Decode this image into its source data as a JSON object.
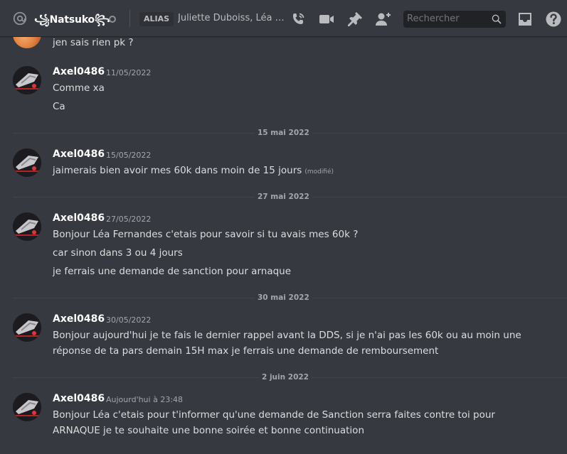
{
  "header": {
    "channel_name": "꧁Natsuko꧂",
    "alias_badge": "ALIAS",
    "alias_names": "Juliette Duboiss, Léa Fernandes",
    "search_placeholder": "Rechercher"
  },
  "messages": {
    "partial": {
      "text": "jen sais rien pk ?"
    },
    "groups": [
      {
        "author": "Axel0486",
        "timestamp": "11/05/2022",
        "lines": [
          "Comme xa",
          "Ca"
        ]
      },
      {
        "author": "Axel0486",
        "timestamp": "15/05/2022",
        "lines": [
          "jaimerais bien avoir mes 60k dans moin de 15 jours"
        ],
        "edited": "(modifié)"
      },
      {
        "author": "Axel0486",
        "timestamp": "27/05/2022",
        "lines": [
          "Bonjour Léa Fernandes c'etais pour savoir si tu avais mes 60k ?",
          "car sinon dans 3 ou 4 jours",
          "je ferrais une demande de sanction pour arnaque"
        ]
      },
      {
        "author": "Axel0486",
        "timestamp": "30/05/2022",
        "lines": [
          "Bonjour aujourd'hui je te fais le dernier rappel avant la DDS, si je n'ai pas les 60k ou au moin une",
          "réponse de ta pars demain 15H max je ferrais une demande de remboursement"
        ]
      },
      {
        "author": "Axel0486",
        "timestamp": "Aujourd'hui à 23:48",
        "lines": [
          "Bonjour Léa c'etais pour t'informer qu'une demande de Sanction serra faites contre toi pour",
          "ARNAQUE je te souhaite une bonne soirée et bonne continuation"
        ]
      }
    ],
    "day_separators": [
      "15 mai 2022",
      "27 mai 2022",
      "30 mai 2022",
      "2 juin 2022"
    ]
  },
  "colors": {
    "background": "#36393f",
    "header_text": "#ffffff",
    "message_text": "#dcddde",
    "muted_text": "#a3a6aa",
    "search_bg": "#202225"
  },
  "icons": [
    "at-icon",
    "status-icon",
    "call-icon",
    "video-icon",
    "pin-icon",
    "add-member-icon",
    "search-icon",
    "inbox-icon",
    "help-icon"
  ]
}
